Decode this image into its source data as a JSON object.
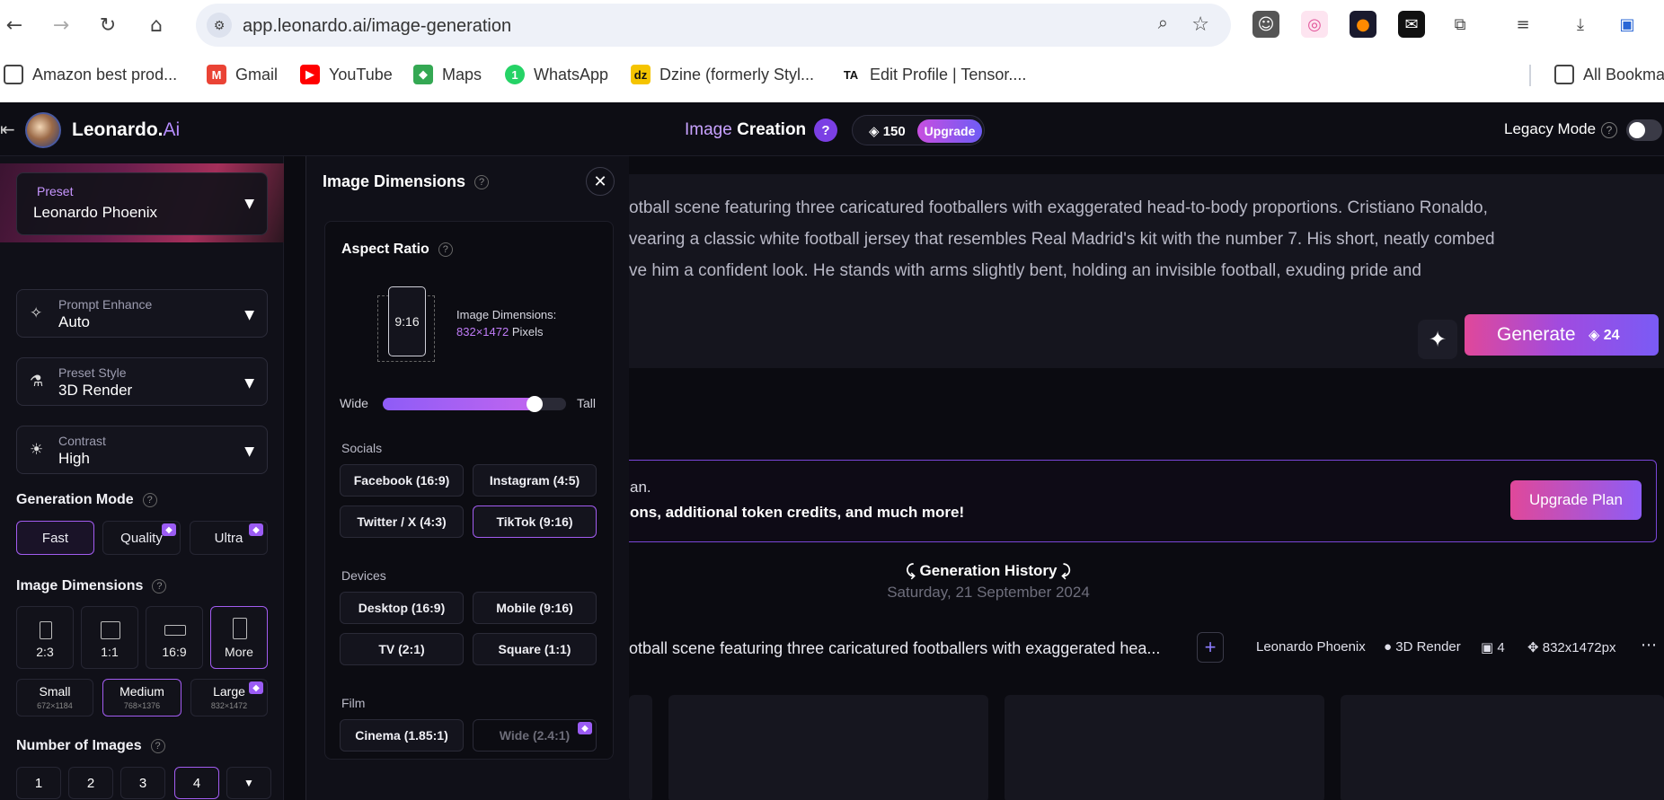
{
  "browser": {
    "url": "app.leonardo.ai/image-generation",
    "bookmarks": [
      "Amazon best prod...",
      "Gmail",
      "YouTube",
      "Maps",
      "WhatsApp",
      "Dzine (formerly Styl...",
      "Edit Profile | Tensor....",
      "All Bookma"
    ]
  },
  "header": {
    "brand_name": "Leonardo.",
    "brand_ai": "Ai",
    "title_image": "Image",
    "title_creation": "Creation",
    "help": "?",
    "tokens": "150",
    "upgrade": "Upgrade",
    "legacy_mode": "Legacy Mode",
    "legacy_help": "?"
  },
  "sidebar": {
    "preset_label": "Preset",
    "preset_value": "Leonardo Phoenix",
    "prompt_enhance_label": "Prompt Enhance",
    "prompt_enhance_value": "Auto",
    "preset_style_label": "Preset Style",
    "preset_style_value": "3D Render",
    "contrast_label": "Contrast",
    "contrast_value": "High",
    "generation_mode_title": "Generation Mode",
    "modes": [
      "Fast",
      "Quality",
      "Ultra"
    ],
    "image_dimensions_title": "Image Dimensions",
    "dims": [
      "2:3",
      "1:1",
      "16:9",
      "More"
    ],
    "sizes": [
      {
        "label": "Small",
        "sub": "672×1184"
      },
      {
        "label": "Medium",
        "sub": "768×1376"
      },
      {
        "label": "Large",
        "sub": "832×1472"
      }
    ],
    "number_of_images_title": "Number of Images",
    "numbers": [
      "1",
      "2",
      "3",
      "4"
    ]
  },
  "dim_panel": {
    "title": "Image Dimensions",
    "aspect_ratio_title": "Aspect Ratio",
    "ratio": "9:16",
    "dims_label": "Image Dimensions:",
    "dims_value": "832×1472",
    "dims_unit": "Pixels",
    "slider_wide": "Wide",
    "slider_tall": "Tall",
    "slider_value": 0.86,
    "socials_title": "Socials",
    "socials": [
      "Facebook (16:9)",
      "Instagram (4:5)",
      "Twitter / X (4:3)",
      "TikTok (9:16)"
    ],
    "devices_title": "Devices",
    "devices": [
      "Desktop (16:9)",
      "Mobile (9:16)",
      "TV (2:1)",
      "Square (1:1)"
    ],
    "film_title": "Film",
    "film": [
      "Cinema (1.85:1)",
      "Wide (2.4:1)"
    ]
  },
  "main": {
    "prompt_line1": "otball scene featuring three caricatured footballers with exaggerated head-to-body proportions. Cristiano Ronaldo,",
    "prompt_line2": "vearing a classic white football jersey that resembles Real Madrid's kit with the number 7. His short, neatly combed",
    "prompt_line3": "ve him a confident look. He stands with arms slightly bent, holding an invisible football, exuding pride and",
    "generate": "Generate",
    "generate_cost": "24",
    "banner_line1": "an.",
    "banner_line2": "ons, additional token credits, and much more!",
    "upgrade_plan": "Upgrade Plan",
    "history_title": "Generation History",
    "history_date": "Saturday, 21 September 2024",
    "row_prompt": "otball scene featuring three caricatured footballers with exaggerated hea...",
    "row_model": "Leonardo Phoenix",
    "row_style": "3D Render",
    "row_count": "4",
    "row_size": "832x1472px",
    "row_more": "⋯"
  }
}
